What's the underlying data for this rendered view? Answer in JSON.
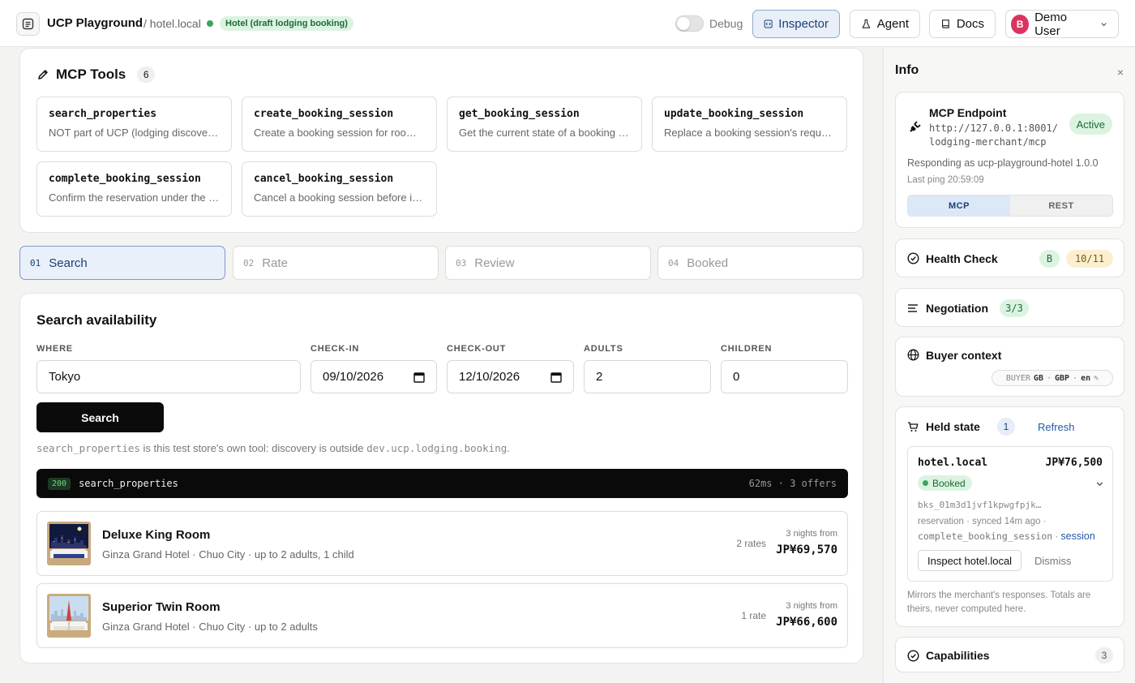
{
  "header": {
    "app_title": "UCP Playground",
    "crumb": "/ hotel.local",
    "env_badge": "Hotel (draft lodging booking)",
    "debug_label": "Debug",
    "inspector_label": "Inspector",
    "agent_label": "Agent",
    "docs_label": "Docs",
    "user_initial": "B",
    "user_name": "Demo User"
  },
  "tools": {
    "title": "MCP Tools",
    "count": "6",
    "items": [
      {
        "name": "search_properties",
        "desc": "NOT part of UCP (lodging discovery is out of scope)"
      },
      {
        "name": "create_booking_session",
        "desc": "Create a booking session for room rates"
      },
      {
        "name": "get_booking_session",
        "desc": "Get the current state of a booking session"
      },
      {
        "name": "update_booking_session",
        "desc": "Replace a booking session's request"
      },
      {
        "name": "complete_booking_session",
        "desc": "Confirm the reservation under the session"
      },
      {
        "name": "cancel_booking_session",
        "desc": "Cancel a booking session before it completes"
      }
    ]
  },
  "steps": [
    {
      "num": "01",
      "label": "Search"
    },
    {
      "num": "02",
      "label": "Rate"
    },
    {
      "num": "03",
      "label": "Review"
    },
    {
      "num": "04",
      "label": "Booked"
    }
  ],
  "search": {
    "title": "Search availability",
    "where_label": "WHERE",
    "where_value": "Tokyo",
    "checkin_label": "CHECK-IN",
    "checkin_value": "09/10/2026",
    "checkout_label": "CHECK-OUT",
    "checkout_value": "12/10/2026",
    "adults_label": "ADULTS",
    "adults_value": "2",
    "children_label": "CHILDREN",
    "children_value": "0",
    "button": "Search",
    "note_tool": "search_properties",
    "note_mid": " is this test store's own tool: discovery is outside ",
    "note_cap": "dev.ucp.lodging.booking",
    "note_end": "."
  },
  "log": {
    "status": "200",
    "tool": "search_properties",
    "meta": "62ms · 3 offers"
  },
  "rooms": [
    {
      "name": "Deluxe King Room",
      "sub": "Ginza Grand Hotel · Chuo City · up to 2 adults, 1 child",
      "rates": "2 rates",
      "from": "3 nights from",
      "price": "JP¥69,570"
    },
    {
      "name": "Superior Twin Room",
      "sub": "Ginza Grand Hotel · Chuo City · up to 2 adults",
      "rates": "1 rate",
      "from": "3 nights from",
      "price": "JP¥66,600"
    }
  ],
  "panel": {
    "title": "Info",
    "close": "×",
    "endpoint": {
      "title": "MCP Endpoint",
      "url_line1": "http://127.0.0.1:8001/",
      "url_line2": "lodging-merchant/mcp",
      "status": "Active",
      "responding": "Responding as ucp-playground-hotel 1.0.0",
      "ping": "Last ping 20:59:09",
      "seg_mcp": "MCP",
      "seg_rest": "REST"
    },
    "health": {
      "title": "Health Check",
      "grade": "B",
      "score": "10/11"
    },
    "negotiation": {
      "title": "Negotiation",
      "score": "3/3"
    },
    "buyer": {
      "title": "Buyer context",
      "tag": "BUYER",
      "country": "GB",
      "currency": "GBP",
      "lang": "en",
      "edit": "✎"
    },
    "held": {
      "title": "Held state",
      "count": "1",
      "refresh": "Refresh",
      "hotel": "hotel.local",
      "price": "JP¥76,500",
      "status": "Booked",
      "id": "bks_01m3d1jvf1kpwgfpjk…",
      "meta1": "reservation · synced 14m ago ·",
      "meta_tool": "complete_booking_session",
      "meta_sep": " · ",
      "meta_link": "session",
      "inspect": "Inspect hotel.local",
      "dismiss": "Dismiss",
      "footnote": "Mirrors the merchant's responses. Totals are theirs, never computed here."
    },
    "capabilities": {
      "title": "Capabilities",
      "count": "3"
    }
  }
}
